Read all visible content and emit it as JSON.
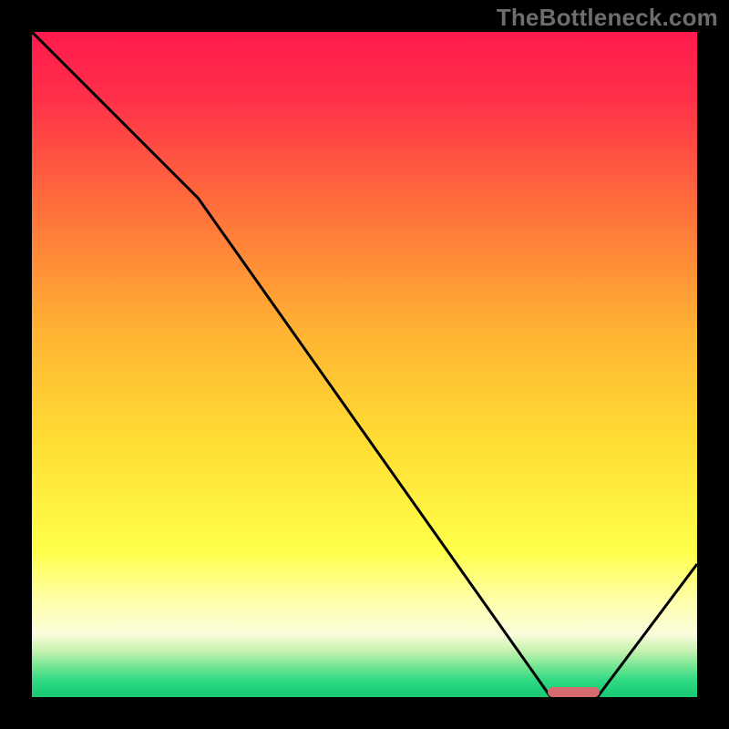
{
  "watermark": "TheBottleneck.com",
  "chart_data": {
    "type": "line",
    "title": "",
    "xlabel": "",
    "ylabel": "",
    "xlim": [
      0,
      100
    ],
    "ylim": [
      0,
      100
    ],
    "x": [
      0,
      25,
      78,
      85,
      100
    ],
    "values": [
      100,
      75,
      0,
      0,
      20
    ],
    "ideal_range_x": [
      78,
      85
    ],
    "background_gradient_stops": [
      {
        "stop": 0.0,
        "color": "#ff1a4d"
      },
      {
        "stop": 0.1,
        "color": "#ff3049"
      },
      {
        "stop": 0.25,
        "color": "#ff6a3c"
      },
      {
        "stop": 0.45,
        "color": "#ffb333"
      },
      {
        "stop": 0.62,
        "color": "#ffde33"
      },
      {
        "stop": 0.78,
        "color": "#ffff4a"
      },
      {
        "stop": 0.86,
        "color": "#ffffb0"
      },
      {
        "stop": 0.905,
        "color": "#fafddc"
      },
      {
        "stop": 0.93,
        "color": "#c8f2b0"
      },
      {
        "stop": 0.955,
        "color": "#6fe592"
      },
      {
        "stop": 0.975,
        "color": "#2fd983"
      },
      {
        "stop": 1.0,
        "color": "#15c972"
      }
    ],
    "curve_stroke": "#000000",
    "curve_stroke_width": 3,
    "ideal_marker_color": "#d56a6f"
  }
}
